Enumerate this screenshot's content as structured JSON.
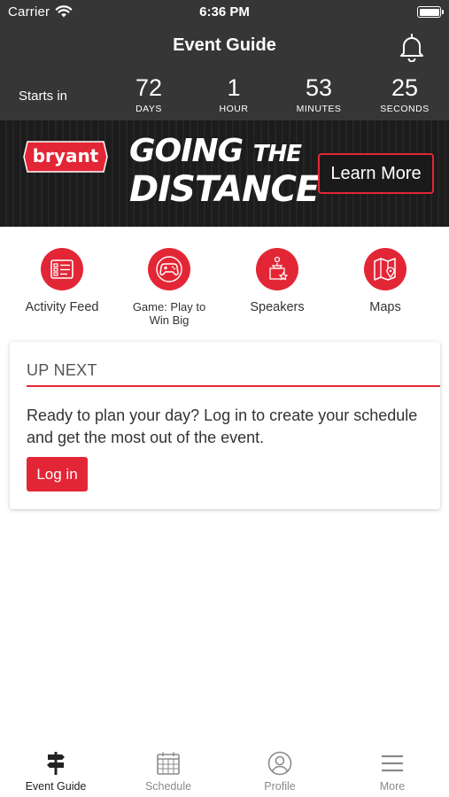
{
  "status_bar": {
    "carrier": "Carrier",
    "time": "6:36 PM"
  },
  "header": {
    "title": "Event Guide",
    "notification_icon": "bell-icon"
  },
  "countdown": {
    "label": "Starts in",
    "units": [
      {
        "value": "72",
        "unit": "DAYS"
      },
      {
        "value": "1",
        "unit": "HOUR"
      },
      {
        "value": "53",
        "unit": "MINUTES"
      },
      {
        "value": "25",
        "unit": "SECONDS"
      }
    ]
  },
  "banner": {
    "logo_text": "bryant",
    "headline_line1_a": "GOING",
    "headline_line1_b": "THE",
    "headline_line2": "DISTANCE",
    "cta_label": "Learn More"
  },
  "quick_links": [
    {
      "label": "Activity Feed",
      "icon": "list-icon"
    },
    {
      "label": "Game: Play to Win Big",
      "icon": "gamepad-icon"
    },
    {
      "label": "Speakers",
      "icon": "speaker-podium-icon"
    },
    {
      "label": "Maps",
      "icon": "map-icon"
    }
  ],
  "up_next": {
    "heading": "UP NEXT",
    "message": "Ready to plan your day? Log in to create your schedule and get the most out of the event.",
    "login_label": "Log in"
  },
  "tab_bar": [
    {
      "label": "Event Guide",
      "icon": "signpost-icon",
      "active": true
    },
    {
      "label": "Schedule",
      "icon": "calendar-icon",
      "active": false
    },
    {
      "label": "Profile",
      "icon": "profile-icon",
      "active": false
    },
    {
      "label": "More",
      "icon": "menu-icon",
      "active": false
    }
  ],
  "colors": {
    "accent": "#e32636",
    "header_bg": "#363636",
    "banner_bg": "#1a1a1a"
  }
}
